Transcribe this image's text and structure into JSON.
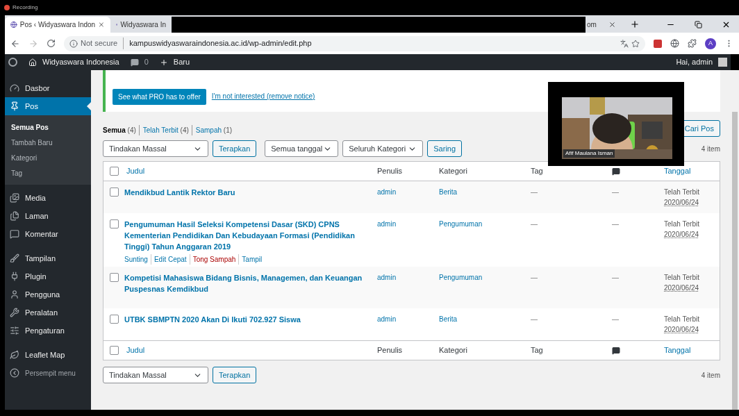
{
  "recording": {
    "label": "Recording"
  },
  "browser": {
    "tabs": [
      {
        "title": "Pos ‹ Widyaswara Indon",
        "selected": true
      },
      {
        "title": "Widyaswara In",
        "selected": false
      },
      {
        "title": "om",
        "selected": false
      }
    ],
    "address": {
      "security": "Not secure",
      "url": "kampuswidyaswaraindonesia.ac.id/wp-admin/edit.php"
    },
    "profile": "A"
  },
  "admin_bar": {
    "site": "Widyaswara Indonesia",
    "comments": "0",
    "new": "Baru",
    "greeting": "Hai, admin"
  },
  "sidebar": {
    "groups": [
      [
        {
          "label": "Dasbor",
          "selected": false
        },
        {
          "label": "Pos",
          "selected": true,
          "children": [
            {
              "label": "Semua Pos",
              "selected": true
            },
            {
              "label": "Tambah Baru",
              "selected": false
            },
            {
              "label": "Kategori",
              "selected": false
            },
            {
              "label": "Tag",
              "selected": false
            }
          ]
        },
        {
          "label": "Media",
          "selected": false
        },
        {
          "label": "Laman",
          "selected": false
        },
        {
          "label": "Komentar",
          "selected": false
        }
      ],
      [
        {
          "label": "Tampilan",
          "selected": false
        },
        {
          "label": "Plugin",
          "selected": false
        },
        {
          "label": "Pengguna",
          "selected": false
        },
        {
          "label": "Peralatan",
          "selected": false
        },
        {
          "label": "Pengaturan",
          "selected": false
        }
      ],
      [
        {
          "label": "Leaflet Map",
          "selected": false
        },
        {
          "label": "Persempit menu",
          "selected": false,
          "kind": "collapse"
        }
      ]
    ]
  },
  "notice": {
    "button": "See what PRO has to offer",
    "link": "I'm not interested (remove notice)"
  },
  "views": [
    {
      "label": "Semua",
      "count": "(4)",
      "selected": true
    },
    {
      "label": "Telah Terbit",
      "count": "(4)",
      "selected": false
    },
    {
      "label": "Sampah",
      "count": "(1)",
      "selected": false
    }
  ],
  "search_button": "Cari Pos",
  "filters": {
    "bulk_action": "Tindakan Massal",
    "apply": "Terapkan",
    "date": "Semua tanggal",
    "category": "Seluruh Kategori",
    "filter": "Saring",
    "count": "4 item"
  },
  "table": {
    "select_all": {
      "checked": false
    },
    "select_all_footer": {
      "checked": false
    },
    "columns": [
      {
        "label": "Judul",
        "kind": "link"
      },
      {
        "label": "Penulis",
        "kind": "text"
      },
      {
        "label": "Kategori",
        "kind": "text"
      },
      {
        "label": "Tag",
        "kind": "text"
      },
      {
        "kind": "icon"
      },
      {
        "label": "Tanggal",
        "kind": "link"
      }
    ],
    "rows": [
      {
        "checked": false,
        "title": "Mendikbud Lantik Rektor Baru",
        "author": "admin",
        "category": "Berita",
        "tag": "—",
        "comments": "—",
        "status": "Telah Terbit",
        "date": "2020/06/24"
      },
      {
        "checked": false,
        "title": "Pengumuman Hasil Seleksi Kompetensi Dasar (SKD) CPNS Kementerian Pendidikan Dan Kebudayaan Formasi (Pendidikan Tinggi) Tahun Anggaran 2019",
        "author": "admin",
        "category": "Pengumuman",
        "tag": "—",
        "comments": "—",
        "status": "Telah Terbit",
        "date": "2020/06/24",
        "actions": [
          {
            "label": "Sunting",
            "kind": "normal"
          },
          {
            "label": "Edit Cepat",
            "kind": "normal"
          },
          {
            "label": "Tong Sampah",
            "kind": "delete"
          },
          {
            "label": "Tampil",
            "kind": "normal"
          }
        ]
      },
      {
        "checked": false,
        "title": "Kompetisi Mahasiswa Bidang Bisnis, Managemen, dan Keuangan Puspesnas Kemdikbud",
        "author": "admin",
        "category": "Pengumuman",
        "tag": "—",
        "comments": "—",
        "status": "Telah Terbit",
        "date": "2020/06/24"
      },
      {
        "checked": false,
        "title": "UTBK SBMPTN 2020 Akan Di Ikuti 702.927 Siswa",
        "author": "admin",
        "category": "Berita",
        "tag": "—",
        "comments": "—",
        "status": "Telah Terbit",
        "date": "2020/06/24"
      }
    ],
    "footer_columns": [
      {
        "label": "Judul",
        "kind": "link"
      },
      {
        "label": "Penulis",
        "kind": "text"
      },
      {
        "label": "Kategori",
        "kind": "text"
      },
      {
        "label": "Tag",
        "kind": "text"
      },
      {
        "kind": "icon"
      },
      {
        "label": "Tanggal",
        "kind": "link"
      }
    ]
  },
  "bottom_filters": {
    "bulk_action": "Tindakan Massal",
    "apply": "Terapkan",
    "count": "4 item"
  },
  "video_overlay": {
    "name": "Afif Maulana Isman"
  }
}
